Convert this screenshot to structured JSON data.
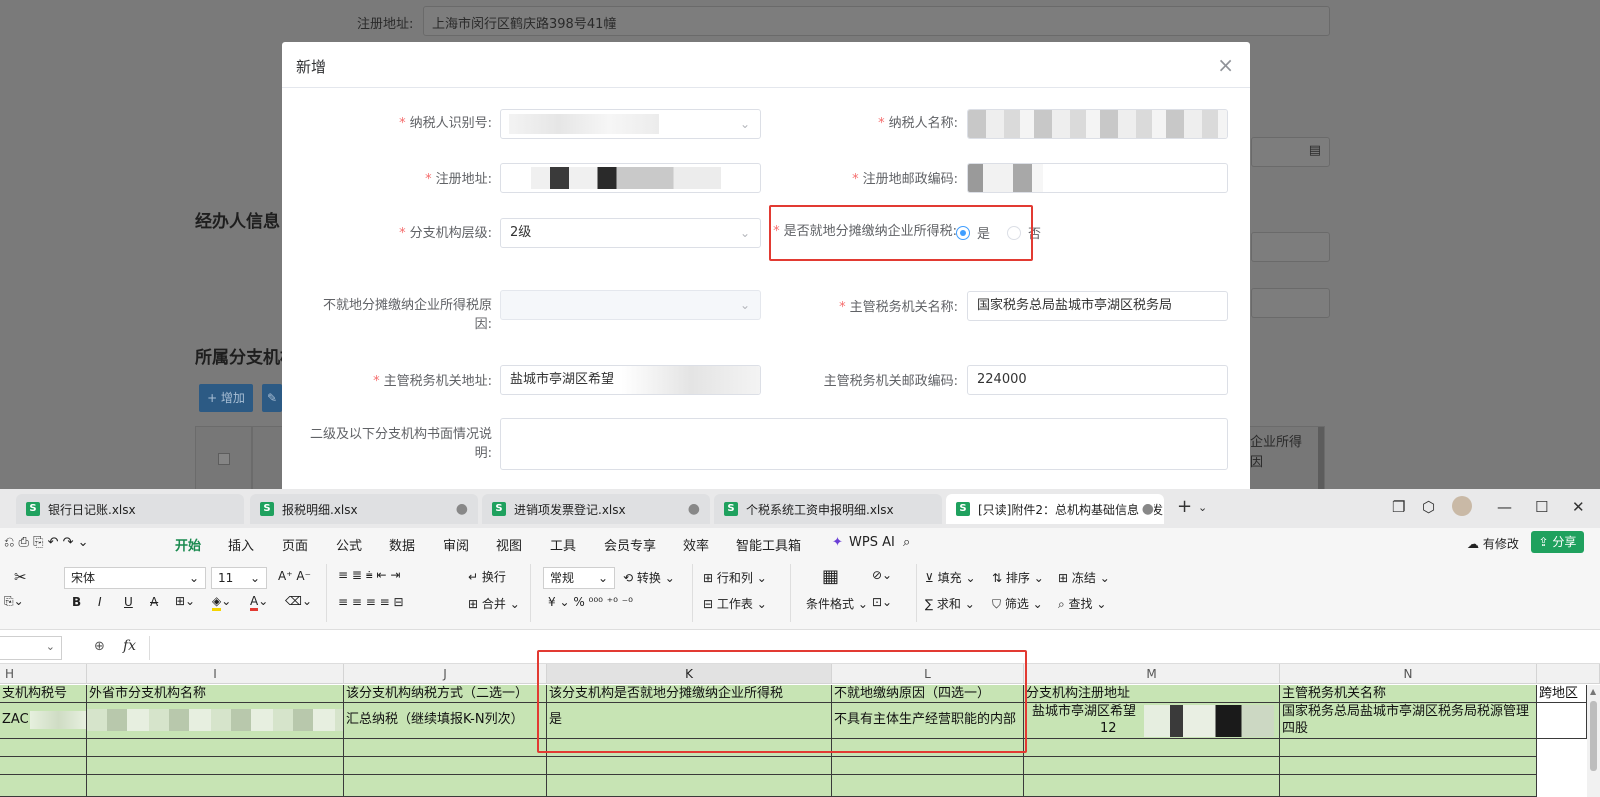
{
  "background": {
    "reg_address_label": "注册地址:",
    "reg_address_value": "上海市闵行区鹤庆路398号41幢",
    "section_agent": "经办人信息",
    "section_branch": "所属分支机构",
    "add_button": "+ 增加",
    "table_header_partial": "缴纳企业所得税原因"
  },
  "modal": {
    "title": "新增",
    "close": "×",
    "fields": {
      "taxpayer_id_label": "纳税人识别号:",
      "taxpayer_name_label": "纳税人名称:",
      "reg_address_label": "注册地址:",
      "reg_postcode_label": "注册地邮政编码:",
      "branch_level_label": "分支机构层级:",
      "branch_level_value": "2级",
      "local_share_label": "是否就地分摊缴纳企业所得税:",
      "radio_yes": "是",
      "radio_no": "否",
      "not_local_reason_label": "不就地分摊缴纳企业所得税原因:",
      "tax_authority_name_label": "主管税务机关名称:",
      "tax_authority_name_value": "国家税务总局盐城市亭湖区税务局",
      "tax_authority_address_label": "主管税务机关地址:",
      "tax_authority_address_value": "盐城市亭湖区希望",
      "tax_authority_postcode_label": "主管税务机关邮政编码:",
      "tax_authority_postcode_value": "224000",
      "secondary_branch_label": "二级及以下分支机构书面情况说明:"
    }
  },
  "wps": {
    "tabs": [
      {
        "label": "银行日记账.xlsx"
      },
      {
        "label": "报税明细.xlsx"
      },
      {
        "label": "进销项发票登记.xlsx"
      },
      {
        "label": "个税系统工资申报明细.xlsx"
      },
      {
        "label": "[只读]附件2：总机构基础信息（发"
      }
    ],
    "menu": [
      "开始",
      "插入",
      "页面",
      "公式",
      "数据",
      "审阅",
      "视图",
      "工具",
      "会员专享",
      "效率",
      "智能工具箱",
      "WPS AI"
    ],
    "modified": "有修改",
    "share": "分享",
    "ribbon": {
      "font": "宋体",
      "font_size": "11",
      "wrap": "换行",
      "merge": "合并",
      "format": "常规",
      "convert": "转换",
      "rows_cols": "行和列",
      "worksheet": "工作表",
      "cond_format": "条件格式",
      "fill": "填充",
      "sort": "排序",
      "freeze": "冻结",
      "sum": "求和",
      "filter": "筛选",
      "find": "查找"
    },
    "fx": "fx",
    "columns": [
      "H",
      "I",
      "J",
      "K",
      "L",
      "M",
      "N"
    ],
    "header_row": {
      "h": "支机构税号",
      "i": "外省市分支机构名称",
      "j": "该分支机构纳税方式（二选一）",
      "k": "该分支机构是否就地分摊缴纳企业所得税",
      "l": "不就地缴纳原因（四选一）",
      "m": "分支机构注册地址",
      "n": "主管税务机关名称",
      "o": "跨地区"
    },
    "data_row": {
      "h": "ZAC",
      "j": "汇总纳税（继续填报K-N列次）",
      "k": "是",
      "l": "不具有主体生产经营职能的内部",
      "m": "盐城市亭湖区希望",
      "m2": "12",
      "n": "国家税务总局盐城市亭湖区税务局税源管理四股"
    }
  }
}
